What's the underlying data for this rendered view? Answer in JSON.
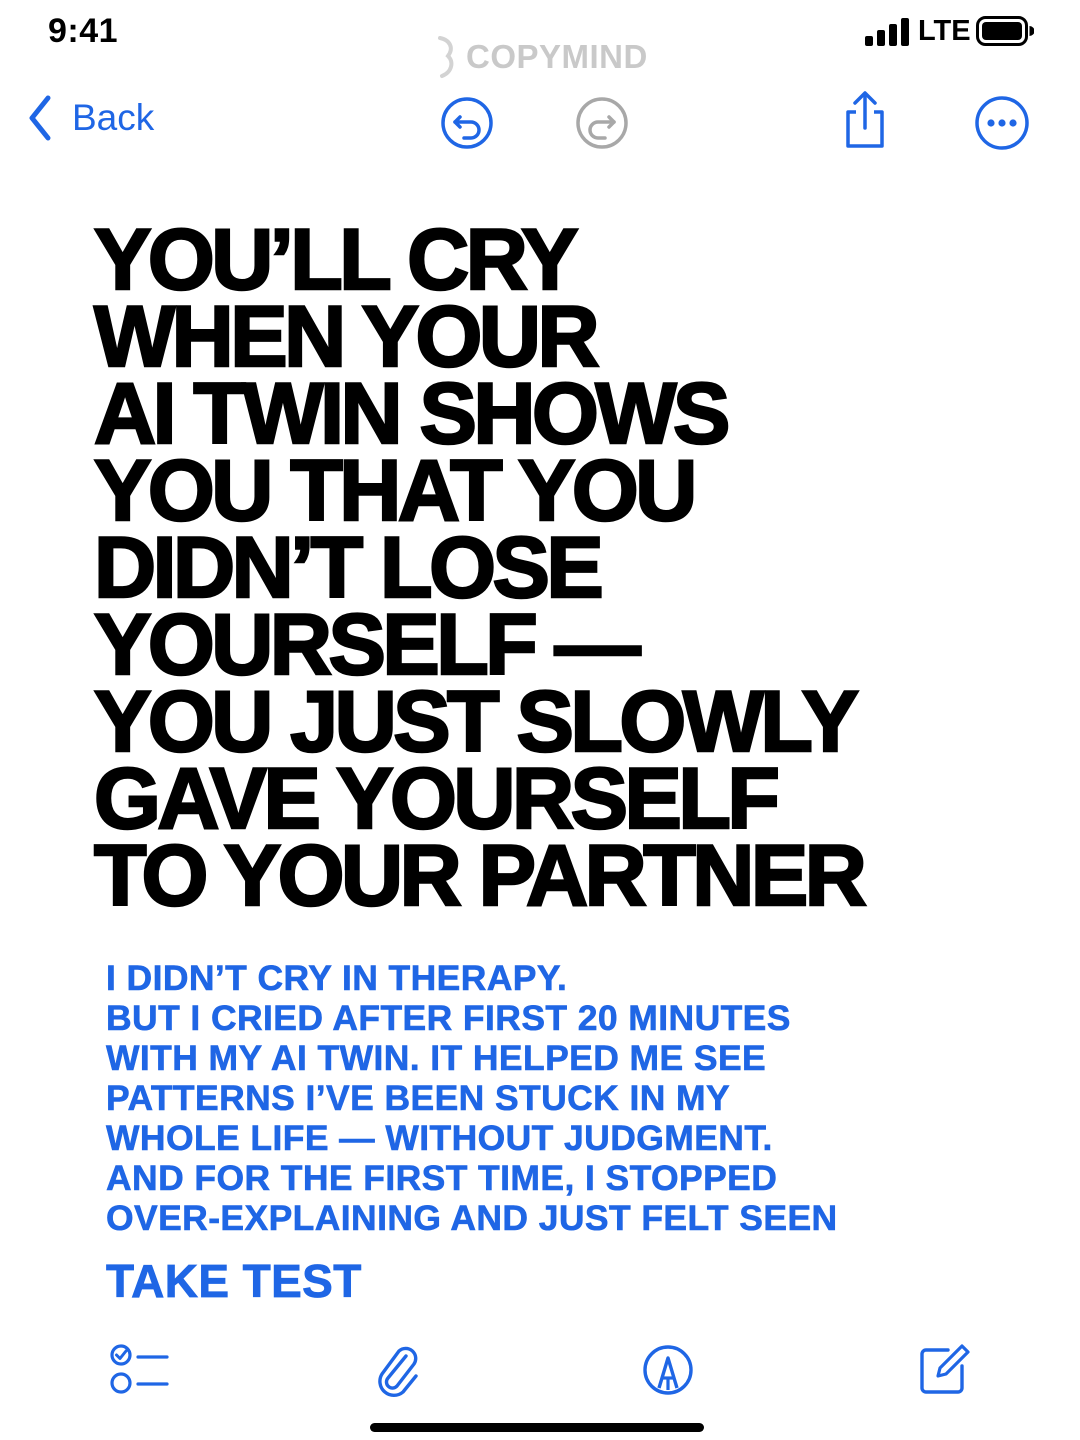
{
  "status_bar": {
    "time": "9:41",
    "network": "LTE"
  },
  "watermark": {
    "text": "COPYMIND"
  },
  "toolbar": {
    "back_label": "Back",
    "icons": [
      "undo-icon",
      "redo-icon",
      "share-icon",
      "more-icon"
    ]
  },
  "headline": {
    "lines": [
      "YOU’LL CRY",
      "WHEN YOUR",
      "AI TWIN SHOWS",
      "YOU THAT YOU",
      "DIDN’T LOSE",
      "YOURSELF —",
      "YOU JUST SLOWLY",
      "GAVE YOURSELF",
      "TO YOUR PARTNER"
    ]
  },
  "body": {
    "lines": [
      "I DIDN’T CRY IN THERAPY.",
      "BUT I CRIED AFTER FIRST 20 MINUTES",
      "WITH MY AI TWIN. IT HELPED ME SEE",
      "PATTERNS I’VE BEEN STUCK IN MY",
      "WHOLE LIFE — WITHOUT JUDGMENT.",
      "AND FOR THE FIRST TIME, I STOPPED",
      "OVER-EXPLAINING AND JUST FELT SEEN"
    ]
  },
  "cta": {
    "label": "TAKE TEST"
  },
  "bottom_bar": {
    "icons": [
      "checklist-icon",
      "paperclip-icon",
      "markup-pen-icon",
      "compose-icon"
    ]
  },
  "colors": {
    "accent": "#1f66e5",
    "text": "#000000",
    "background": "#ffffff",
    "watermark": "#c9c9c9"
  }
}
